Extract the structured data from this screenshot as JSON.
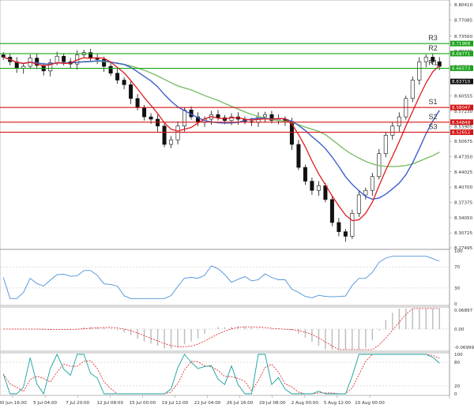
{
  "colors": {
    "candle": "#111111",
    "ma_fast": "#e3191c",
    "ma_mid": "#3d5ecc",
    "ma_slow": "#7bbf6a",
    "resistance": "#1aa21a",
    "support": "#d41414",
    "current_tag": "#111111",
    "rsi": "#4a90d9",
    "macd_hist": "#bbbbbb",
    "macd_signal": "#e3191c",
    "stoch_k": "#18a0a0",
    "stoch_d": "#e3191c"
  },
  "chart_data": [
    {
      "type": "candlestick",
      "title": "",
      "y_ticks": [
        "8.80410",
        "8.77085",
        "8.73560",
        "8.70235",
        "8.66910",
        "8.63880",
        "8.60555",
        "8.57230",
        "8.53905",
        "8.50675",
        "8.47350",
        "8.44025",
        "8.40700",
        "8.37375",
        "8.34050",
        "8.30725",
        "8.27495"
      ],
      "ylim": [
        8.27495,
        8.8041
      ],
      "x_ticks": [
        "30 Jun 16:00",
        "5 Jul 04:00",
        "7 Jul 20:00",
        "12 Jul 08:00",
        "15 Jul 00:00",
        "19 Jul 12:00",
        "22 Jul 04:00",
        "26 Jul 16:00",
        "29 Jul 08:00",
        "2 Aug 00:00",
        "5 Aug 12:00",
        "10 Aug 00:00"
      ],
      "current_price": "8.63710",
      "levels": [
        {
          "name": "R3",
          "value": "8.71968",
          "kind": "resistance"
        },
        {
          "name": "R2",
          "value": "8.69771",
          "kind": "resistance"
        },
        {
          "name": "R1",
          "value": "8.66573",
          "kind": "resistance"
        },
        {
          "name": "S1",
          "value": "8.58047",
          "kind": "support"
        },
        {
          "name": "S2",
          "value": "8.54849",
          "kind": "support"
        },
        {
          "name": "S3",
          "value": "8.52652",
          "kind": "support"
        }
      ],
      "close": [
        8.69,
        8.68,
        8.666,
        8.67,
        8.688,
        8.672,
        8.66,
        8.678,
        8.692,
        8.68,
        8.675,
        8.695,
        8.7,
        8.688,
        8.685,
        8.67,
        8.655,
        8.64,
        8.63,
        8.6,
        8.58,
        8.56,
        8.555,
        8.54,
        8.5,
        8.51,
        8.54,
        8.575,
        8.56,
        8.548,
        8.555,
        8.565,
        8.558,
        8.552,
        8.56,
        8.555,
        8.55,
        8.548,
        8.56,
        8.565,
        8.552,
        8.555,
        8.55,
        8.5,
        8.45,
        8.42,
        8.4,
        8.41,
        8.38,
        8.33,
        8.31,
        8.3,
        8.35,
        8.39,
        8.4,
        8.43,
        8.48,
        8.52,
        8.54,
        8.56,
        8.6,
        8.64,
        8.68,
        8.69,
        8.68,
        8.67
      ],
      "indicators": {
        "rsi": {
          "ticks": [
            "100",
            "70",
            "30",
            "0"
          ]
        },
        "macd": {
          "ticks": [
            "0.06897",
            "0.00",
            "-0.06999"
          ]
        },
        "stochastic": {
          "ticks": [
            "100",
            "80",
            "20",
            "0"
          ]
        }
      }
    }
  ]
}
